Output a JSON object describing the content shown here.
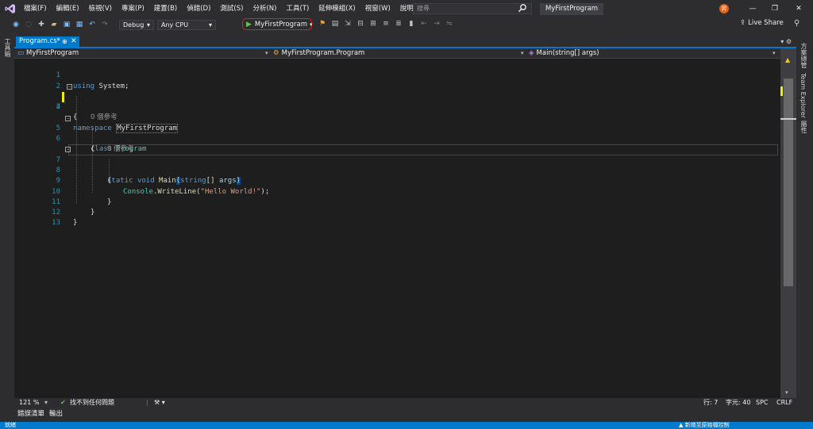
{
  "menu": {
    "items": [
      "檔案(F)",
      "編輯(E)",
      "檢視(V)",
      "專案(P)",
      "建置(B)",
      "偵錯(D)",
      "測試(S)",
      "分析(N)",
      "工具(T)",
      "延伸模組(X)",
      "視窗(W)",
      "說明(H)"
    ],
    "search_placeholder": "搜尋",
    "app_title": "MyFirstProgram",
    "user_initial": "昇",
    "minimize": "—",
    "restore": "❐",
    "close": "✕"
  },
  "toolbar": {
    "config": "Debug",
    "platform": "Any CPU",
    "run_label": "MyFirstProgram",
    "live_share": "Live Share"
  },
  "left_strip": {
    "label": "工具箱"
  },
  "right_strip": {
    "solution_explorer": "方案總管",
    "team_explorer": "Team Explorer",
    "properties": "屬性"
  },
  "tab": {
    "name": "Program.cs*",
    "pin": "⊕",
    "close": "✕"
  },
  "navbar": {
    "project": "MyFirstProgram",
    "class": "MyFirstProgram.Program",
    "member": "Main(string[] args)"
  },
  "code": {
    "line_numbers": [
      "1",
      "2",
      "3",
      "4",
      "5",
      "6",
      "7",
      "8",
      "9",
      "10",
      "11",
      "12",
      "13"
    ],
    "l1_kw": "using",
    "l1_rest": " System;",
    "l3_kw": "namespace",
    "l3_ns": "MyFirstProgram",
    "l4": "{",
    "ref1": "0 個參考",
    "l5_kw": "class",
    "l5_ty": "Program",
    "l6": "{",
    "ref2": "0 個參考",
    "l7_kw1": "static",
    "l7_kw2": "void",
    "l7_fn": "Main",
    "l7_p1": "(",
    "l7_kw3": "string",
    "l7_p2": "[] ",
    "l7_arg": "args",
    "l7_p3": ")",
    "l8": "{",
    "l9_ty": "Console",
    "l9_fn": ".WriteLine(",
    "l9_str": "\"Hello World!\"",
    "l9_end": ");",
    "l10": "}",
    "l11": "}",
    "l12": "}"
  },
  "editor_status": {
    "zoom": "121 %",
    "issues": "找不到任何問題",
    "line": "行: 7",
    "col": "字元: 40",
    "spc": "SPC",
    "crlf": "CRLF"
  },
  "bottom_tabs": [
    "錯誤清單",
    "輸出"
  ],
  "statusbar": {
    "ready": "就緒",
    "source_control": "新增至原始檔控制"
  }
}
